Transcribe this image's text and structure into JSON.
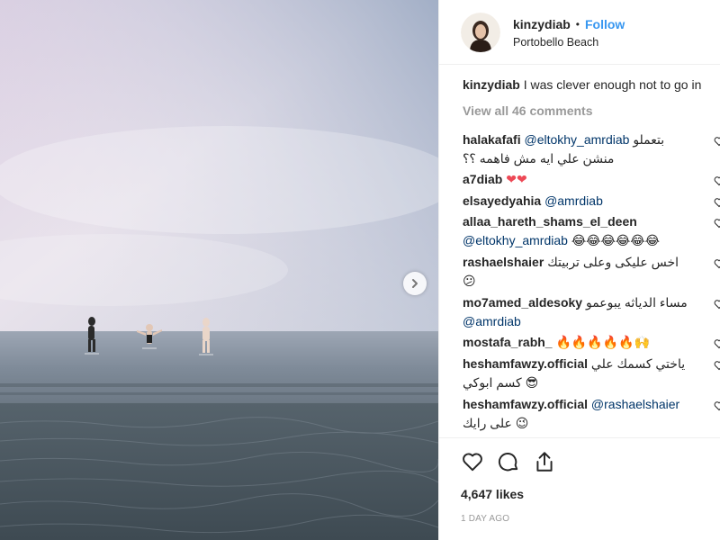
{
  "post": {
    "username": "kinzydiab",
    "follow_label": "Follow",
    "separator": "•",
    "location": "Portobello Beach"
  },
  "caption": {
    "username": "kinzydiab",
    "text": "I was clever enough not to go in"
  },
  "view_all": "View all 46 comments",
  "comments": [
    {
      "username": "halakafafi",
      "mention": "@eltokhy_amrdiab",
      "pre_text": "بتعملو",
      "text": "منشن علي ايه مش فاهمه ؟؟"
    },
    {
      "username": "a7diab",
      "emoji": "❤❤"
    },
    {
      "username": "elsayedyahia",
      "mention": "@amrdiab"
    },
    {
      "username": "allaa_hareth_shams_el_deen",
      "mention": "@eltokhy_amrdiab",
      "emoji": "😂😂😂😂😂😂"
    },
    {
      "username": "rashaelshaier",
      "text": "اخس عليكى وعلى تربيتك",
      "emoji": "😕"
    },
    {
      "username": "mo7amed_aldesoky",
      "text": "مساء الدياثه يبوعمو",
      "mention": "@amrdiab"
    },
    {
      "username": "mostafa_rabh_",
      "emoji": "🔥🔥🔥🔥🔥🙌"
    },
    {
      "username": "heshamfawzy.official",
      "text": "ياختي كسمك علي",
      "text2": "كسم ابوكي",
      "emoji": "😎"
    },
    {
      "username": "heshamfawzy.official",
      "mention": "@rashaelshaier",
      "text": "على رايك",
      "emoji": "😉"
    }
  ],
  "likes": "4,647 likes",
  "timestamp": "1 DAY AGO",
  "colors": {
    "accent": "#3897f0",
    "mention": "#003569",
    "muted": "#999999",
    "heart_red": "#ed4956"
  },
  "icons": [
    "heart-icon",
    "comment-icon",
    "share-icon",
    "chevron-right-icon"
  ]
}
